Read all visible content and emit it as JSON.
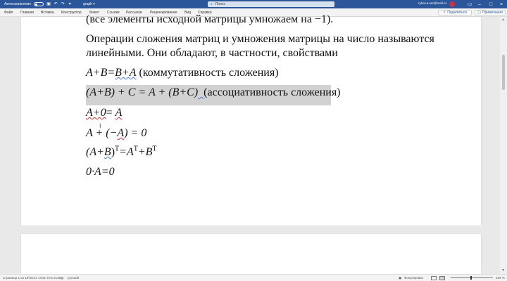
{
  "titlebar": {
    "autosave_label": "Автосохранение",
    "doc_title": "graph ▾",
    "search_placeholder": "Поиск",
    "account": "ryhev.a.ser@mail.ru"
  },
  "ribbon": {
    "tabs": [
      "Файл",
      "Главная",
      "Вставка",
      "Конструктор",
      "Макет",
      "Ссылки",
      "Рассылки",
      "Рецензирование",
      "Вид",
      "Справка"
    ],
    "share_label": "Поделиться",
    "comments_label": "Примечания"
  },
  "document": {
    "line1": "(все элементы исходной матрицы умножаем на −1).",
    "para1_line1": "Операции сложения матриц и умножения матрицы на число называются",
    "para1_line2": "линейными. Они обладают, в частности, свойствами",
    "f1_lhs": "A+B=",
    "f1_b": "B+A",
    "f1_note": " (коммутативность сложения)",
    "f2_expr1": "(A+B) + C = A + (B+C)",
    "f2_gap": "  ",
    "f2_note": "(ассоциативность сложения)",
    "f3_a": "A+0",
    "f3_eq": "= ",
    "f3_b": "A",
    "f4_a": "A + (−",
    "f4_b": "A",
    "f4_c": ") = 0",
    "f5_a": "(A+",
    "f5_b": "B",
    "f5_c": ")",
    "f5_t1": "T",
    "f5_d": "=A",
    "f5_t2": "T",
    "f5_e": "+B",
    "f5_t3": "T",
    "f6": "0·A=0"
  },
  "statusbar": {
    "page": "Страница 1 из 13",
    "words": "Число слов: 9 из 2128",
    "language": "русский",
    "focus": "Фокусировка",
    "zoom": "220 %"
  }
}
